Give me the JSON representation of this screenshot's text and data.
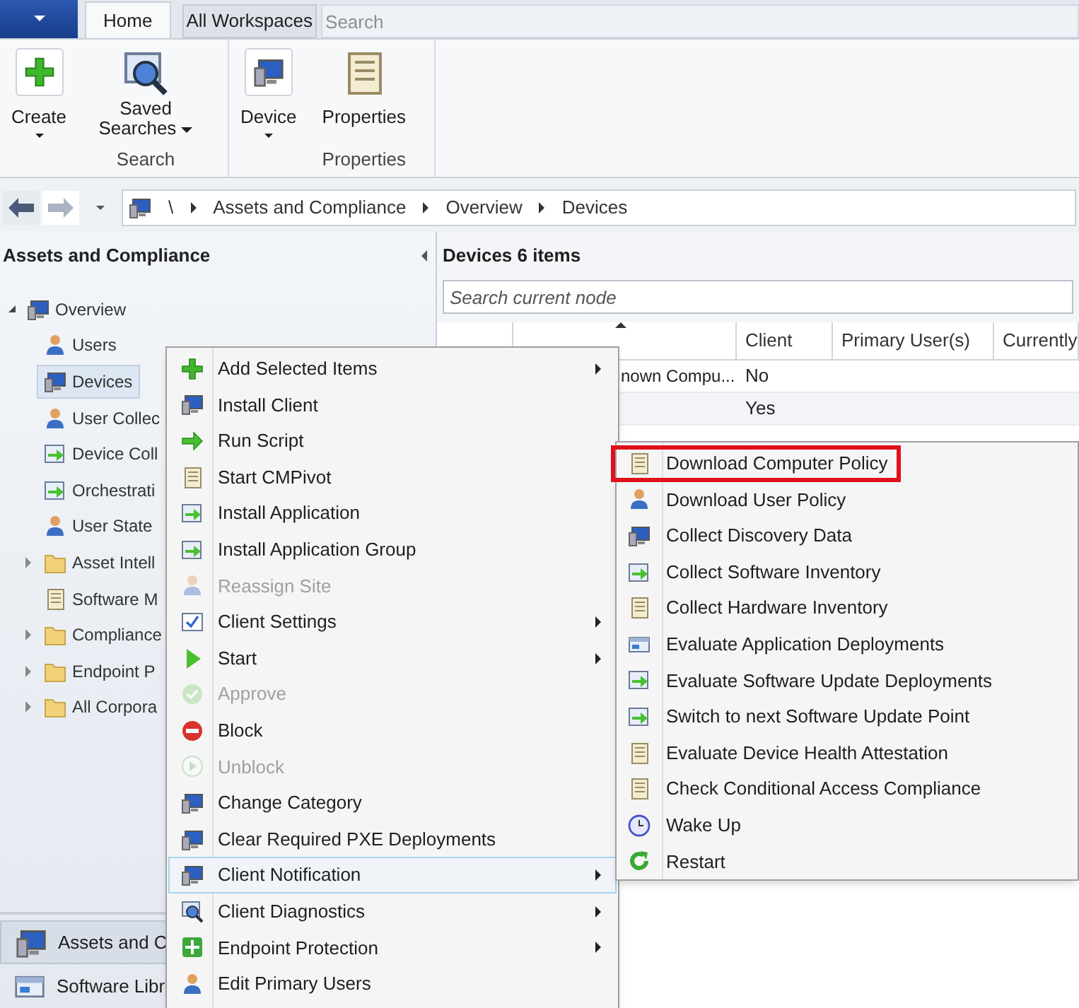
{
  "ribbon": {
    "tabs": [
      {
        "label": "Home",
        "selected": true
      },
      {
        "label": "All Workspaces",
        "selected": false
      }
    ],
    "search": {
      "placeholder": "Search"
    },
    "groups": [
      {
        "buttons": [
          {
            "label": "Create",
            "caret_below": true
          }
        ]
      },
      {
        "label": "Search",
        "buttons": [
          {
            "label": "Saved Searches",
            "caret_inline": true
          }
        ]
      },
      {
        "buttons": [
          {
            "label": "Device",
            "caret_below": true
          }
        ]
      },
      {
        "label": "Properties",
        "buttons": [
          {
            "label": "Properties"
          }
        ]
      }
    ]
  },
  "breadcrumb": [
    "\\",
    "Assets and Compliance",
    "Overview",
    "Devices"
  ],
  "navigation": {
    "title": "Assets and Compliance",
    "tree": [
      {
        "label": "Overview",
        "expanded": true,
        "selected": false,
        "children": [
          {
            "label": "Users",
            "selected": false
          },
          {
            "label": "Devices",
            "selected": true
          },
          {
            "label": "User Collec",
            "selected": false
          },
          {
            "label": "Device Coll",
            "selected": false
          },
          {
            "label": "Orchestrati",
            "selected": false
          },
          {
            "label": "User State",
            "selected": false
          },
          {
            "label": "Asset Intell",
            "expanded": false,
            "selected": false
          },
          {
            "label": "Software M",
            "selected": false
          },
          {
            "label": "Compliance",
            "expanded": false,
            "selected": false
          },
          {
            "label": "Endpoint P",
            "expanded": false,
            "selected": false
          },
          {
            "label": "All Corpora",
            "expanded": false,
            "selected": false
          }
        ]
      }
    ],
    "workspaces": [
      {
        "label": "Assets and C",
        "selected": true
      },
      {
        "label": "Software Libr",
        "selected": false
      }
    ]
  },
  "content": {
    "title": "Devices 6 items",
    "search": {
      "placeholder": "Search current node"
    },
    "columns": [
      {
        "kind": "icon"
      },
      {
        "kind": "name",
        "sorted_ascending": true
      },
      {
        "kind": "text",
        "label": "Client"
      },
      {
        "kind": "text",
        "label": "Primary User(s)"
      },
      {
        "kind": "text",
        "label": "Currently"
      }
    ],
    "rows": [
      {
        "name": "nown Compu...",
        "client": "No"
      },
      {
        "client": "Yes"
      }
    ]
  },
  "context_menu": [
    {
      "label": "Add Selected Items",
      "submenu": true,
      "disabled": false,
      "highlighted": false
    },
    {
      "label": "Install Client",
      "submenu": false,
      "disabled": false,
      "highlighted": false
    },
    {
      "label": "Run Script",
      "submenu": false,
      "disabled": false,
      "highlighted": false
    },
    {
      "label": "Start CMPivot",
      "submenu": false,
      "disabled": false,
      "highlighted": false
    },
    {
      "label": "Install Application",
      "submenu": false,
      "disabled": false,
      "highlighted": false
    },
    {
      "label": "Install Application Group",
      "submenu": false,
      "disabled": false,
      "highlighted": false
    },
    {
      "label": "Reassign Site",
      "submenu": false,
      "disabled": true,
      "highlighted": false
    },
    {
      "label": "Client Settings",
      "submenu": true,
      "disabled": false,
      "highlighted": false
    },
    {
      "label": "Start",
      "submenu": true,
      "disabled": false,
      "highlighted": false
    },
    {
      "label": "Approve",
      "submenu": false,
      "disabled": true,
      "highlighted": false
    },
    {
      "label": "Block",
      "submenu": false,
      "disabled": false,
      "highlighted": false
    },
    {
      "label": "Unblock",
      "submenu": false,
      "disabled": true,
      "highlighted": false
    },
    {
      "label": "Change Category",
      "submenu": false,
      "disabled": false,
      "highlighted": false
    },
    {
      "label": "Clear Required PXE Deployments",
      "submenu": false,
      "disabled": false,
      "highlighted": false
    },
    {
      "label": "Client Notification",
      "submenu": true,
      "disabled": false,
      "highlighted": true
    },
    {
      "label": "Client Diagnostics",
      "submenu": true,
      "disabled": false,
      "highlighted": false
    },
    {
      "label": "Endpoint Protection",
      "submenu": true,
      "disabled": false,
      "highlighted": false
    },
    {
      "label": "Edit Primary Users",
      "submenu": false,
      "disabled": false,
      "highlighted": false
    }
  ],
  "submenu": [
    {
      "label": "Download Computer Policy",
      "marked": true
    },
    {
      "label": "Download User Policy",
      "marked": false
    },
    {
      "label": "Collect Discovery Data",
      "marked": false
    },
    {
      "label": "Collect Software Inventory",
      "marked": false
    },
    {
      "label": "Collect Hardware Inventory",
      "marked": false
    },
    {
      "label": "Evaluate Application Deployments",
      "marked": false
    },
    {
      "label": "Evaluate Software Update Deployments",
      "marked": false
    },
    {
      "label": "Switch to next Software Update Point",
      "marked": false
    },
    {
      "label": "Evaluate Device Health Attestation",
      "marked": false
    },
    {
      "label": "Check Conditional Access Compliance",
      "marked": false
    },
    {
      "label": "Wake Up",
      "marked": false
    },
    {
      "label": "Restart",
      "marked": false
    }
  ]
}
